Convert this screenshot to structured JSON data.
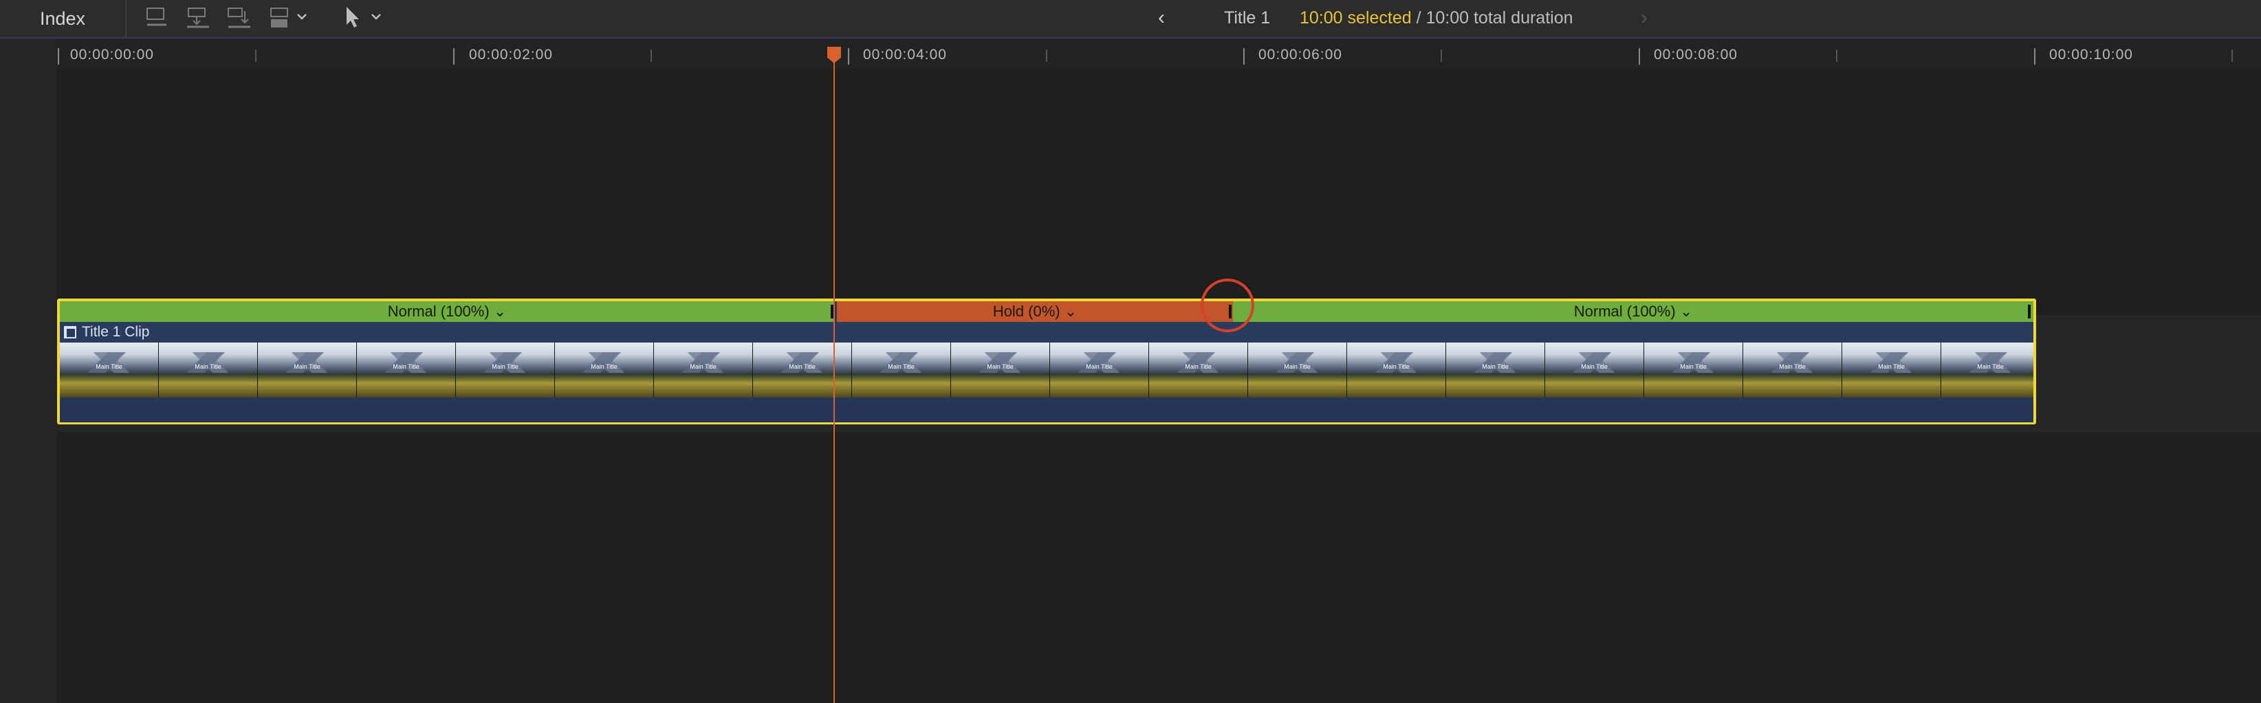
{
  "toolbar": {
    "index_label": "Index",
    "project_title": "Title 1",
    "selected_duration": "10:00 selected",
    "separator": " / ",
    "total_duration": "10:00 total duration",
    "back_arrow": "‹",
    "forward_arrow": "›"
  },
  "ruler": {
    "labels": [
      "00:00:00:00",
      "00:00:02:00",
      "00:00:04:00",
      "00:00:06:00",
      "00:00:08:00",
      "00:00:10:00"
    ]
  },
  "clip": {
    "name": "Title 1 Clip",
    "thumbnail_title": "Main Title",
    "retime_segments": [
      {
        "label": "Normal (100%)",
        "chevron": "⌄",
        "kind": "normal"
      },
      {
        "label": "Hold (0%)",
        "chevron": "⌄",
        "kind": "hold"
      },
      {
        "label": "Normal (100%)",
        "chevron": "⌄",
        "kind": "normal"
      }
    ]
  },
  "colors": {
    "accent_selection": "#f0d73a",
    "retime_normal": "#6fae3e",
    "retime_hold": "#c2552c",
    "playhead": "#d8612f",
    "highlight": "#d8402a"
  },
  "icons": [
    "overwrite-icon",
    "insert-icon",
    "append-icon",
    "connect-icon",
    "select-tool-icon",
    "chevron-down-icon"
  ]
}
